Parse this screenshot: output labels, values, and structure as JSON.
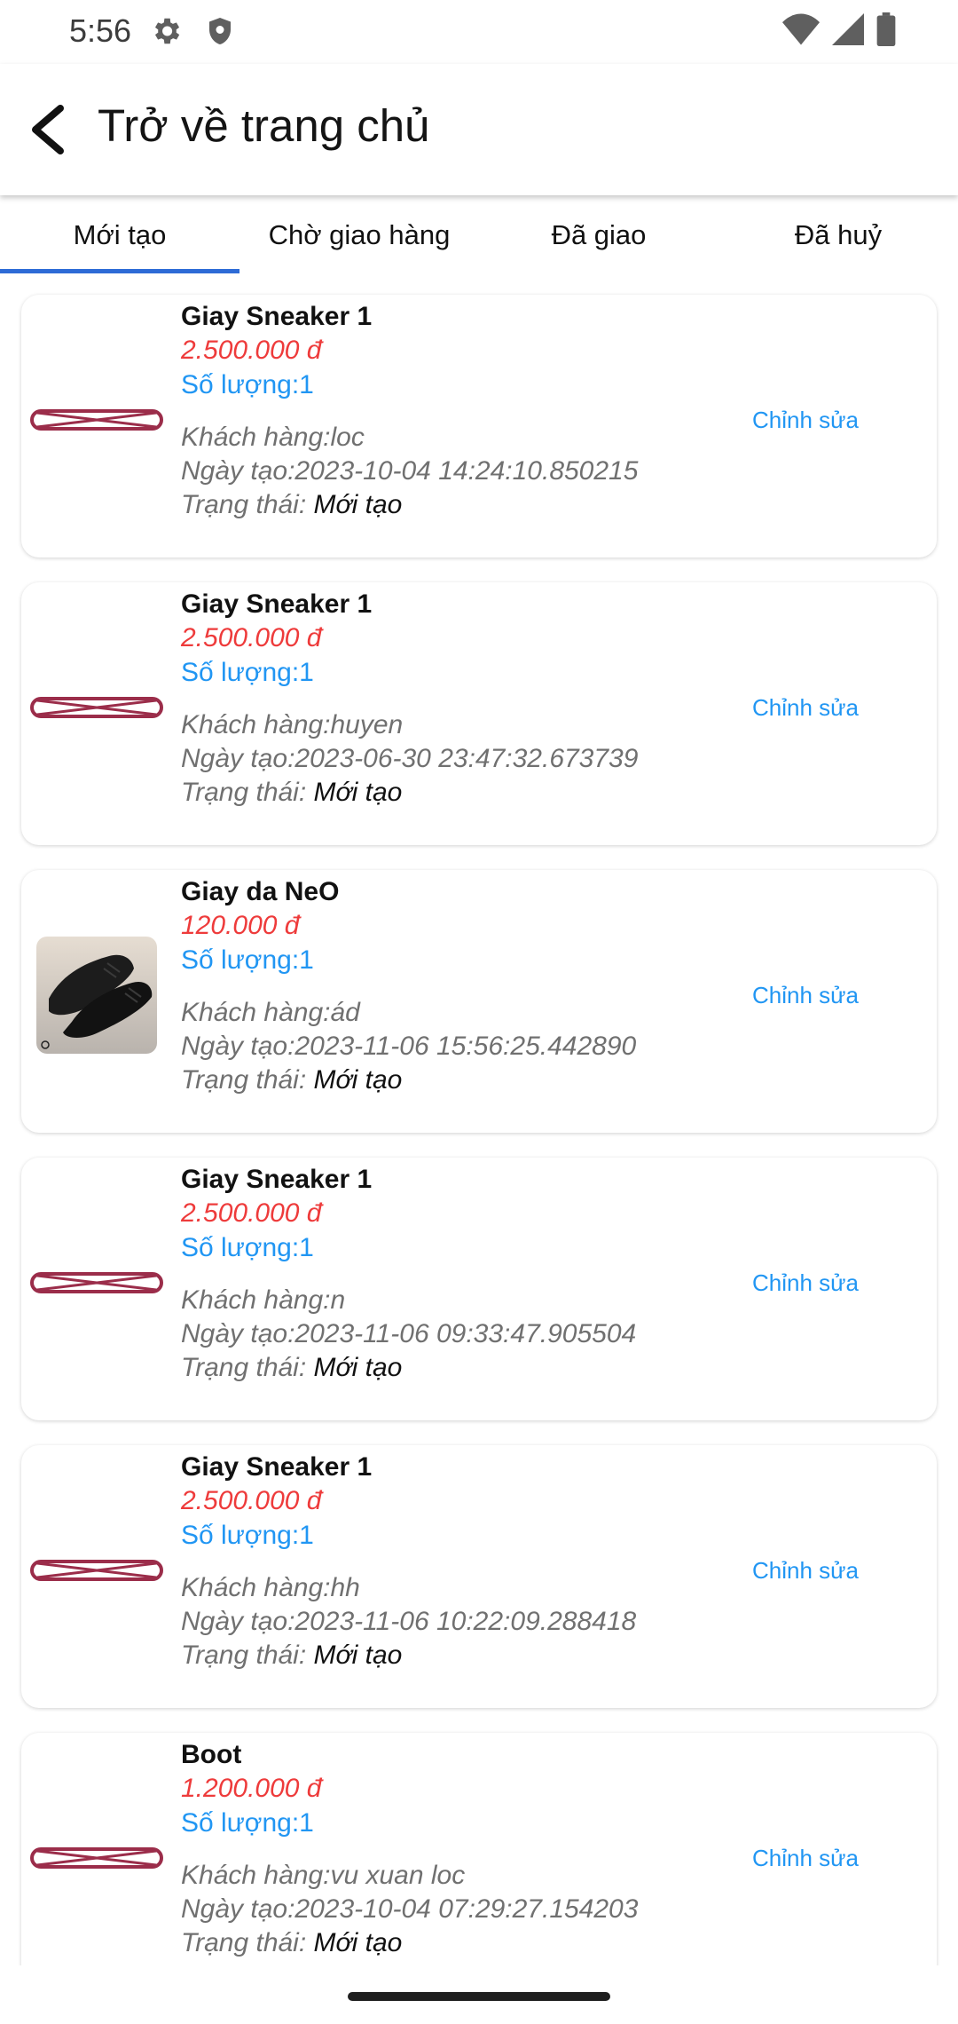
{
  "status_bar": {
    "time": "5:56",
    "icons": [
      "settings-icon",
      "shield-icon",
      "wifi-icon",
      "signal-icon",
      "battery-icon"
    ]
  },
  "app_bar": {
    "back_icon": "arrow-back-icon",
    "title": "Trở về trang chủ"
  },
  "tabs": [
    {
      "label": "Mới tạo",
      "active": true
    },
    {
      "label": "Chờ giao hàng",
      "active": false
    },
    {
      "label": "Đã giao",
      "active": false
    },
    {
      "label": "Đã huỷ",
      "active": false
    }
  ],
  "orders": [
    {
      "product": "Giay Sneaker 1",
      "price": "2.500.000 đ",
      "quantity": "Số lượng:1",
      "customer": "Khách hàng:loc",
      "created": "Ngày tạo:2023-10-04 14:24:10.850215",
      "status_label": "Trạng thái:",
      "status_value": "Mới tạo",
      "edit": "Chỉnh sửa",
      "thumbnail": "broken-image-placeholder"
    },
    {
      "product": "Giay Sneaker 1",
      "price": "2.500.000 đ",
      "quantity": "Số lượng:1",
      "customer": "Khách hàng:huyen",
      "created": "Ngày tạo:2023-06-30 23:47:32.673739",
      "status_label": "Trạng thái:",
      "status_value": "Mới tạo",
      "edit": "Chỉnh sửa",
      "thumbnail": "broken-image-placeholder"
    },
    {
      "product": "Giay da NeO",
      "price": "120.000 đ",
      "quantity": "Số lượng:1",
      "customer": "Khách hàng:ád",
      "created": "Ngày tạo:2023-11-06 15:56:25.442890",
      "status_label": "Trạng thái:",
      "status_value": "Mới tạo",
      "edit": "Chỉnh sửa",
      "thumbnail": "leather-shoe-photo"
    },
    {
      "product": "Giay Sneaker 1",
      "price": "2.500.000 đ",
      "quantity": "Số lượng:1",
      "customer": "Khách hàng:n",
      "created": "Ngày tạo:2023-11-06 09:33:47.905504",
      "status_label": "Trạng thái:",
      "status_value": "Mới tạo",
      "edit": "Chỉnh sửa",
      "thumbnail": "broken-image-placeholder"
    },
    {
      "product": "Giay Sneaker 1",
      "price": "2.500.000 đ",
      "quantity": "Số lượng:1",
      "customer": "Khách hàng:hh",
      "created": "Ngày tạo:2023-11-06 10:22:09.288418",
      "status_label": "Trạng thái:",
      "status_value": "Mới tạo",
      "edit": "Chỉnh sửa",
      "thumbnail": "broken-image-placeholder"
    },
    {
      "product": "Boot",
      "price": "1.200.000 đ",
      "quantity": "Số lượng:1",
      "customer": "Khách hàng:vu xuan loc",
      "created": "Ngày tạo:2023-10-04 07:29:27.154203",
      "status_label": "Trạng thái:",
      "status_value": "Mới tạo",
      "edit": "Chỉnh sửa",
      "thumbnail": "broken-image-placeholder"
    }
  ],
  "colors": {
    "price": "#ee3b3b",
    "quantity": "#2196f3",
    "edit": "#2196f3",
    "tab_indicator": "#2d6bd6",
    "placeholder_stroke": "#9b2d4a"
  }
}
